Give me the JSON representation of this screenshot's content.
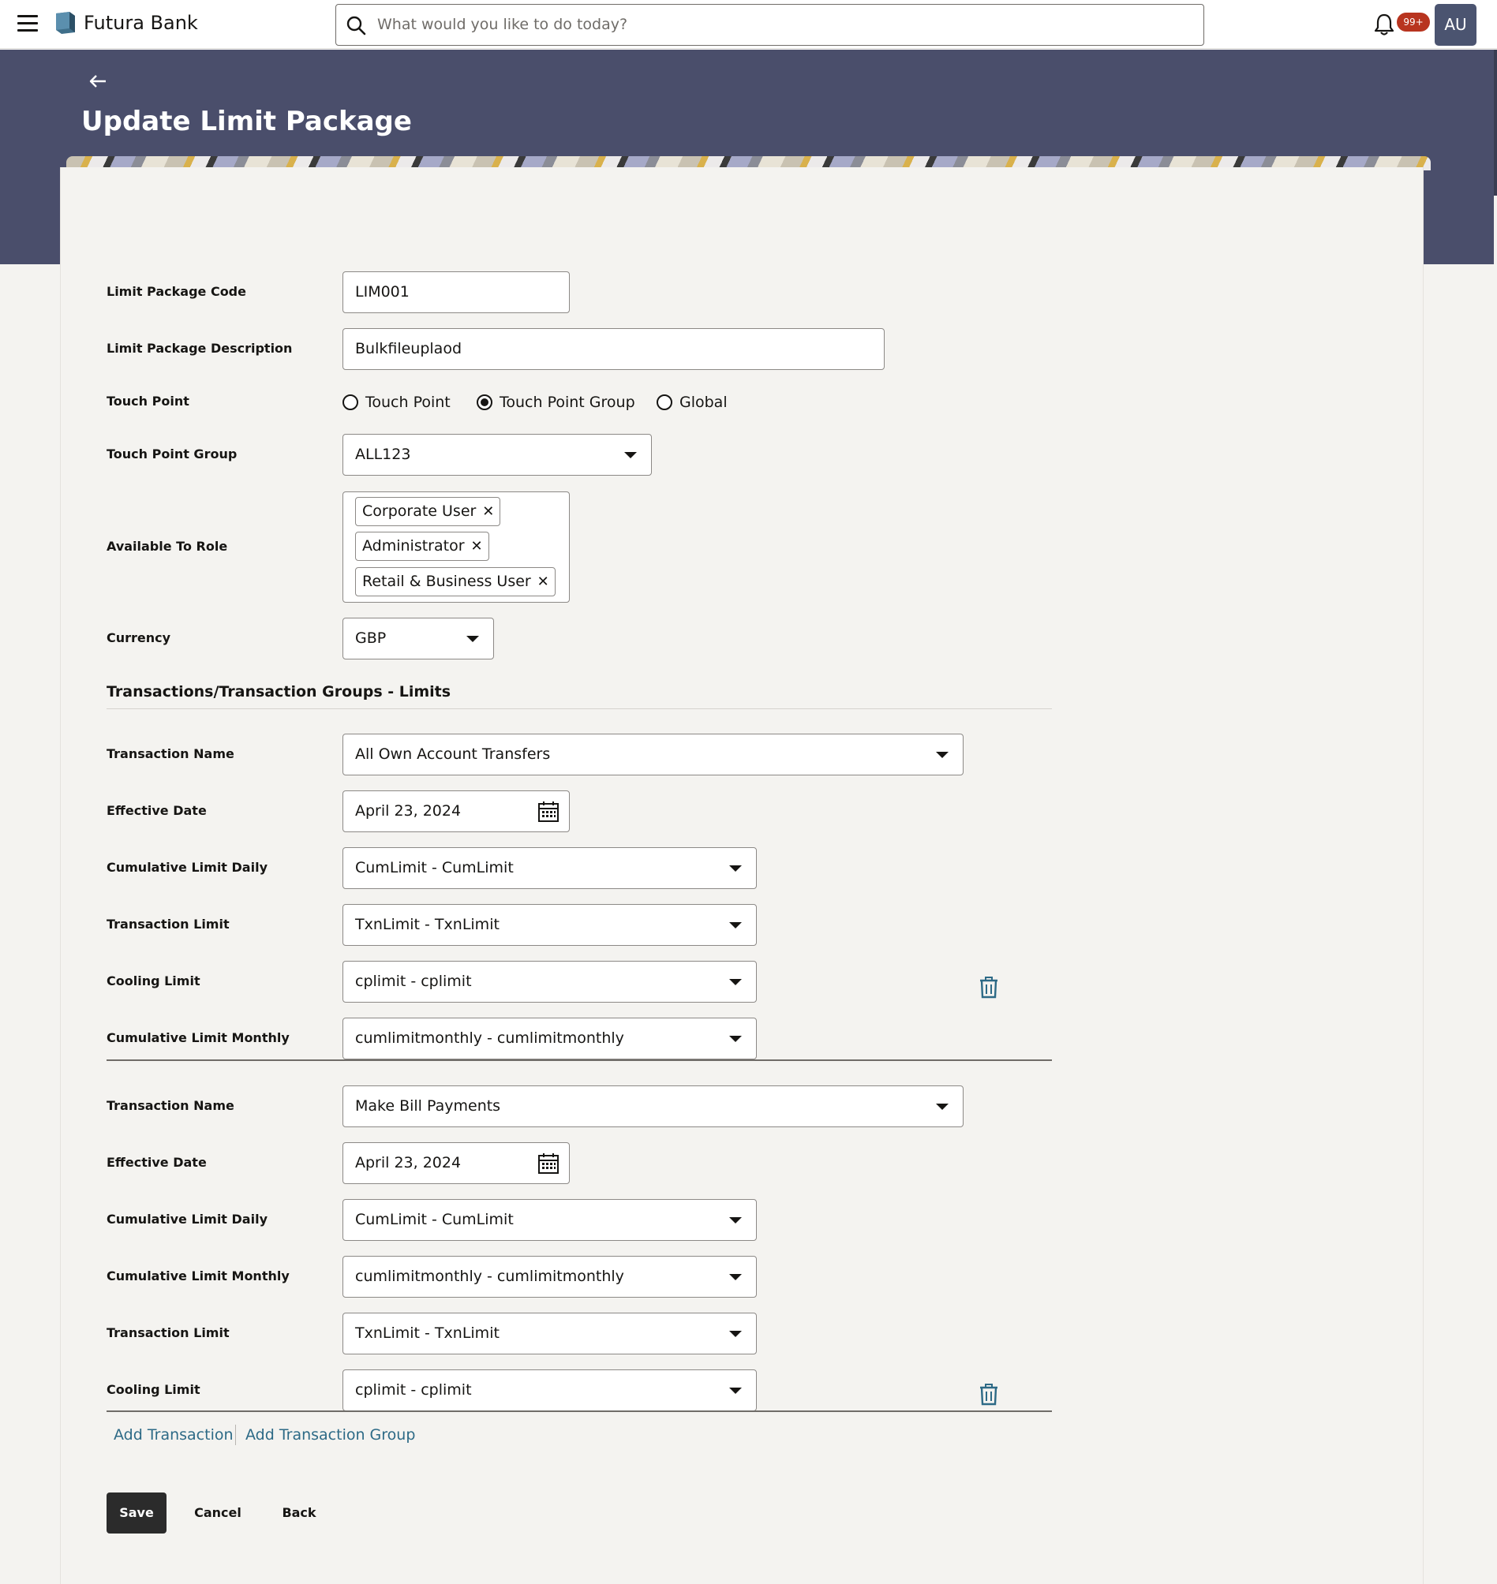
{
  "brand": {
    "name": "Futura Bank"
  },
  "search": {
    "placeholder": "What would you like to do today?"
  },
  "notifications": {
    "badge": "99+"
  },
  "user": {
    "initials": "AU"
  },
  "page": {
    "title": "Update Limit Package"
  },
  "form": {
    "code": {
      "label": "Limit Package Code",
      "value": "LIM001"
    },
    "description": {
      "label": "Limit Package Description",
      "value": "Bulkfileuplaod"
    },
    "touch_point": {
      "label": "Touch Point",
      "options": [
        "Touch Point",
        "Touch Point Group",
        "Global"
      ],
      "selected": "Touch Point Group"
    },
    "touch_point_group": {
      "label": "Touch Point Group",
      "value": "ALL123"
    },
    "available_to_role": {
      "label": "Available To Role",
      "chips": [
        "Corporate User",
        "Administrator",
        "Retail & Business User"
      ],
      "remove_glyph": "✕"
    },
    "currency": {
      "label": "Currency",
      "value": "GBP"
    }
  },
  "limits_section": {
    "title": "Transactions/Transaction Groups - Limits",
    "groups": [
      {
        "transaction_name": {
          "label": "Transaction Name",
          "value": "All Own Account Transfers"
        },
        "effective_date": {
          "label": "Effective Date",
          "value": "April 23, 2024"
        },
        "rows": [
          {
            "label": "Cumulative Limit Daily",
            "value": "CumLimit - CumLimit"
          },
          {
            "label": "Transaction Limit",
            "value": "TxnLimit - TxnLimit"
          },
          {
            "label": "Cooling Limit",
            "value": "cplimit - cplimit"
          },
          {
            "label": "Cumulative Limit Monthly",
            "value": "cumlimitmonthly - cumlimitmonthly"
          }
        ]
      },
      {
        "transaction_name": {
          "label": "Transaction Name",
          "value": "Make Bill Payments"
        },
        "effective_date": {
          "label": "Effective Date",
          "value": "April 23, 2024"
        },
        "rows": [
          {
            "label": "Cumulative Limit Daily",
            "value": "CumLimit - CumLimit"
          },
          {
            "label": "Cumulative Limit Monthly",
            "value": "cumlimitmonthly - cumlimitmonthly"
          },
          {
            "label": "Transaction Limit",
            "value": "TxnLimit - TxnLimit"
          },
          {
            "label": "Cooling Limit",
            "value": "cplimit - cplimit"
          }
        ]
      }
    ],
    "add_transaction": "Add Transaction",
    "add_transaction_group": "Add Transaction Group"
  },
  "actions": {
    "save": "Save",
    "cancel": "Cancel",
    "back": "Back"
  },
  "colors": {
    "header_band": "#4a4e6b",
    "primary_button": "#2b2b2b",
    "link": "#2d6a86",
    "badge": "#b8341f",
    "avatar": "#4b5470"
  }
}
